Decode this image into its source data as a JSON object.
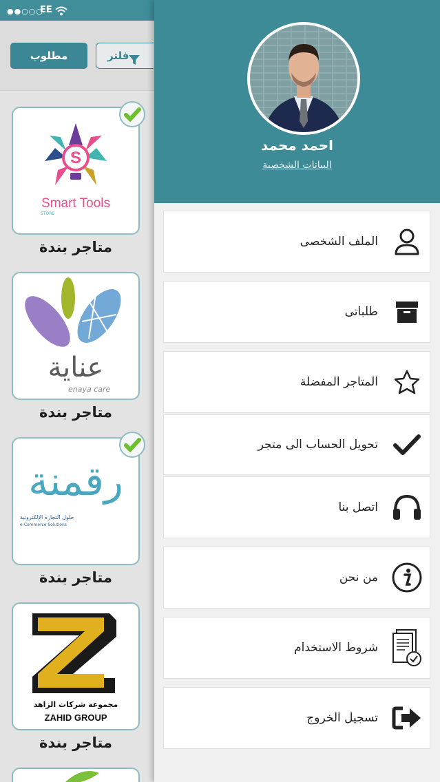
{
  "status_bar": {
    "signal": "●●○○○",
    "carrier": "EE"
  },
  "toolbar": {
    "required_label": "مطلوب",
    "filter_label": "فلتر"
  },
  "stores": [
    {
      "name": "متاجر بندة",
      "logo_text": "Smart Tools",
      "logo_subtext": "STORE",
      "checked": true
    },
    {
      "name": "متاجر بندة",
      "logo_text": "عناية",
      "logo_subtext": "enaya care",
      "checked": false
    },
    {
      "name": "متاجر بندة",
      "logo_text": "رقمنة",
      "logo_subtext": "حلول التجارة الإلكترونية",
      "logo_subtext2": "e-Commerce Solutions",
      "checked": true
    },
    {
      "name": "متاجر بندة",
      "logo_text": "ZAHID GROUP",
      "logo_subtext": "مجموعة شركات الزاهد",
      "checked": false
    }
  ],
  "profile": {
    "name": "احمد محمد",
    "link": "البيانات الشخصية"
  },
  "menu": [
    {
      "label": "الملف الشخصى",
      "icon": "user-icon"
    },
    {
      "label": "طلباتى",
      "icon": "box-icon"
    },
    {
      "label": "المتاجر المفضلة",
      "icon": "star-icon"
    },
    {
      "label": "تحويل الحساب الى متجر",
      "icon": "check-icon"
    },
    {
      "label": "اتصل بنا",
      "icon": "headphones-icon"
    },
    {
      "label": "من نحن",
      "icon": "info-icon"
    },
    {
      "label": "شروط الاستخدام",
      "icon": "document-check-icon"
    },
    {
      "label": "تسجيل الخروج",
      "icon": "logout-icon"
    }
  ],
  "colors": {
    "primary": "#3d8b97",
    "check_green": "#6cbf2d"
  }
}
